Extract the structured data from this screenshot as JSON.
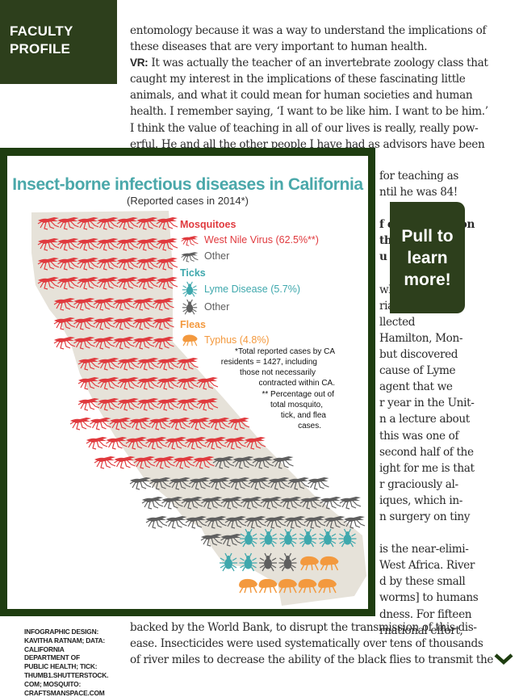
{
  "section": {
    "label_line1": "FACULTY",
    "label_line2": "PROFILE",
    "color": "#2d3f1c"
  },
  "article": {
    "top_lines": [
      "entomology because it was a way to understand the implications of",
      "these diseases that are very important to human health.",
      "It was actually the teacher of an invertebrate zoology class that",
      "caught my interest in the implications of these fascinating little",
      "animals, and what it could mean for human societies and human",
      "health. I remember saying, ‘I want to be like him. I want to be him.’",
      "I think the value of teaching in all of our lives is really, really pow-",
      "erful. He and all the other people I have had as advisors have been"
    ],
    "speaker_label": "VR:",
    "right_lines": [
      {
        "text": "for teaching as",
        "bold": false
      },
      {
        "text": "ntil he was 84!",
        "bold": false
      },
      {
        "text": "",
        "bold": false
      },
      {
        "text": "f entomology on",
        "bold": true
      },
      {
        "text": "the field",
        "bold": true
      },
      {
        "text": "u have",
        "bold": true
      },
      {
        "text": "",
        "bold": false
      },
      {
        "text": "who",
        "bold": false
      },
      {
        "text": "ria]. In",
        "bold": false
      },
      {
        "text": "llected",
        "bold": false
      },
      {
        "text": "Hamilton, Mon-",
        "bold": false
      },
      {
        "text": "but discovered",
        "bold": false
      },
      {
        "text": "cause of Lyme",
        "bold": false
      },
      {
        "text": "agent that we",
        "bold": false
      },
      {
        "text": "r year in the Unit-",
        "bold": false
      },
      {
        "text": "n a lecture about",
        "bold": false
      },
      {
        "text": "this was one of",
        "bold": false
      },
      {
        "text": "second half of the",
        "bold": false
      },
      {
        "text": "ight for me is that",
        "bold": false
      },
      {
        "text": "r graciously al-",
        "bold": false
      },
      {
        "text": "iques, which in-",
        "bold": false
      },
      {
        "text": "n surgery on tiny",
        "bold": false
      },
      {
        "text": "",
        "bold": false
      },
      {
        "text": "is the near-elimi-",
        "bold": false
      },
      {
        "text": "West Africa. River",
        "bold": false
      },
      {
        "text": "d by these small",
        "bold": false
      },
      {
        "text": "worms] to humans",
        "bold": false
      },
      {
        "text": "dness. For fifteen",
        "bold": false
      },
      {
        "text": "rnational effort,",
        "bold": false
      }
    ],
    "bottom_lines": [
      "backed by the World Bank, to disrupt the transmission of this dis-",
      "ease. Insecticides were used systematically over tens of thousands",
      "of river miles to decrease the ability of the black flies to transmit the"
    ]
  },
  "infographic": {
    "title": "Insect-borne infectious diseases in California",
    "subtitle": "(Reported cases in 2014*)",
    "colors": {
      "west_nile": "#e03a3e",
      "other": "#5f5f5f",
      "lyme": "#3fa8ad",
      "typhus": "#f3993e",
      "map_fill": "#e6e2d9",
      "title": "#4aa8aa"
    },
    "legend": {
      "mosquitoes": {
        "heading": "Mosquitoes",
        "items": [
          {
            "label": "West Nile Virus (62.5%**)",
            "icon": "mosquito-icon"
          },
          {
            "label": "Other",
            "icon": "mosquito-icon"
          }
        ]
      },
      "ticks": {
        "heading": "Ticks",
        "items": [
          {
            "label": "Lyme Disease (5.7%)",
            "icon": "tick-icon"
          },
          {
            "label": "Other",
            "icon": "tick-icon"
          }
        ]
      },
      "fleas": {
        "heading": "Fleas",
        "items": [
          {
            "label": "Typhus (4.8%)",
            "icon": "flea-icon"
          }
        ]
      }
    },
    "footnote_lines": [
      "*Total reported cases by CA",
      "residents = 1427, including",
      "those not necessarily",
      "contracted within CA.",
      "** Percentage out of",
      "total mosquito,",
      "tick, and flea",
      "cases."
    ],
    "grid_rows": [
      [
        [
          "wnv",
          7
        ]
      ],
      [
        [
          "wnv",
          7
        ]
      ],
      [
        [
          "wnv",
          7
        ]
      ],
      [
        [
          "wnv",
          7
        ]
      ],
      [
        [
          "wnv",
          6
        ]
      ],
      [
        [
          "wnv",
          6
        ]
      ],
      [
        [
          "wnv",
          6
        ]
      ],
      [
        [
          "wnv",
          6
        ]
      ],
      [
        [
          "wnv",
          7
        ]
      ],
      [
        [
          "wnv",
          7
        ]
      ],
      [
        [
          "wnv",
          9
        ]
      ],
      [
        [
          "wnv",
          9
        ]
      ],
      [
        [
          "wnv",
          6
        ],
        [
          "mos_other",
          4
        ]
      ],
      [
        [
          "mos_other",
          10
        ]
      ],
      [
        [
          "mos_other",
          11
        ]
      ],
      [
        [
          "mos_other",
          11
        ]
      ],
      [
        [
          "mos_other",
          2
        ],
        [
          "lyme",
          6
        ]
      ],
      [
        [
          "lyme",
          2
        ],
        [
          "tick_other",
          2
        ],
        [
          "typhus",
          2
        ]
      ],
      [
        [
          "typhus",
          5
        ]
      ]
    ]
  },
  "pull_tab": {
    "line1": "Pull to",
    "line2": "learn",
    "line3": "more!"
  },
  "credits": "INFOGRAPHIC DESIGN: KAVITHA RATNAM; DATA: CALIFORNIA DEPARTMENT OF PUBLIC HEALTH; TICK: THUMB1.SHUTTERSTOCK. COM; MOSQUITO: CRAFTSMANSPACE.COM",
  "nav": {
    "next_icon": "chevron-down-icon",
    "color": "#1e3d10"
  }
}
